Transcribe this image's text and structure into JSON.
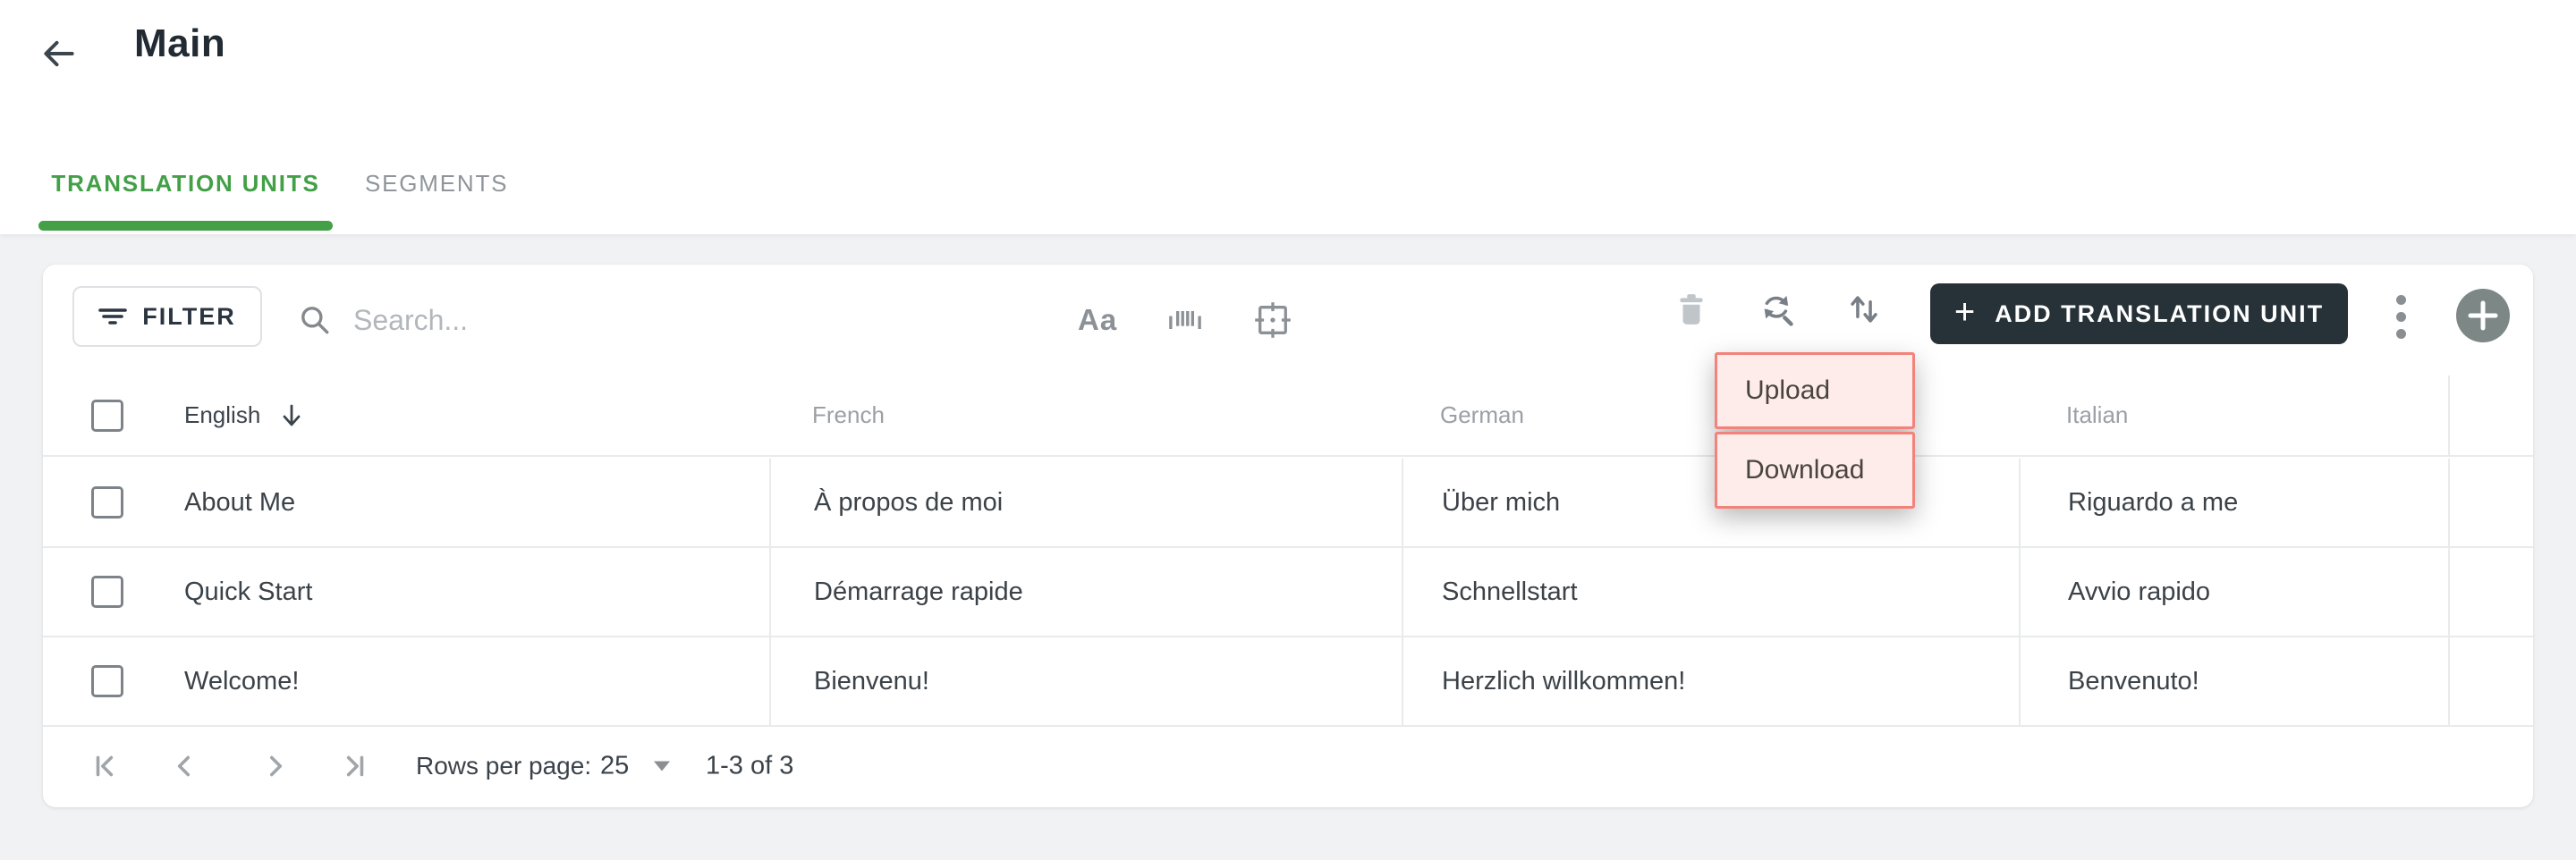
{
  "colors": {
    "accent_green": "#43a047",
    "dark_button_bg": "#263238",
    "annotation_bg": "#fdecea",
    "annotation_border": "#f2827a",
    "page_bg": "#f1f2f4"
  },
  "header": {
    "title": "Main"
  },
  "tabs": {
    "items": [
      {
        "label": "TRANSLATION UNITS",
        "active": true
      },
      {
        "label": "SEGMENTS",
        "active": false
      }
    ]
  },
  "toolbar": {
    "filter": {
      "label": "FILTER"
    },
    "search": {
      "placeholder": "Search...",
      "value": ""
    },
    "text_case_glyph": "Aa",
    "add_button": {
      "plus": "+",
      "label": "ADD TRANSLATION UNIT"
    }
  },
  "menu": {
    "items": [
      {
        "label": "Upload"
      },
      {
        "label": "Download"
      }
    ]
  },
  "table": {
    "columns": [
      {
        "label": "English",
        "sorted": "desc"
      },
      {
        "label": "French"
      },
      {
        "label": "German"
      },
      {
        "label": "Italian"
      }
    ],
    "rows": [
      {
        "english": "About Me",
        "french": "À propos de moi",
        "german": "Über mich",
        "italian": "Riguardo a me"
      },
      {
        "english": "Quick Start",
        "french": "Démarrage rapide",
        "german": "Schnellstart",
        "italian": "Avvio rapido"
      },
      {
        "english": "Welcome!",
        "french": "Bienvenu!",
        "german": "Herzlich willkommen!",
        "italian": "Benvenuto!"
      }
    ]
  },
  "footer": {
    "rows_per_page_label": "Rows per page:",
    "rows_per_page_value": "25",
    "range": "1-3 of 3"
  }
}
